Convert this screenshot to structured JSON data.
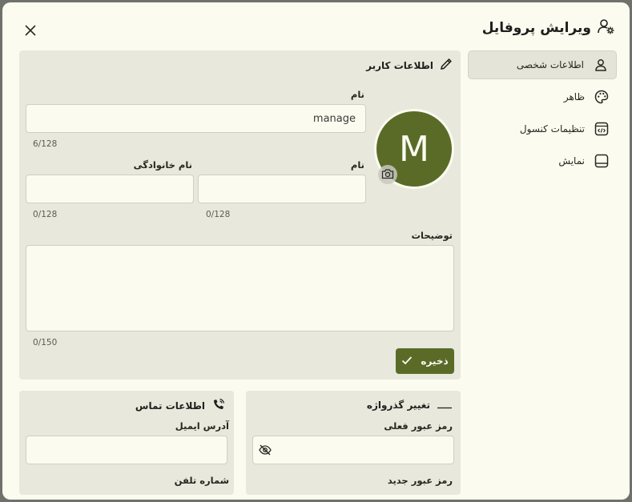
{
  "dialog": {
    "title": "ویرایش پروفایل"
  },
  "sidebar": {
    "items": [
      {
        "label": "اطلاعات شخصی",
        "icon": "person-icon",
        "active": true
      },
      {
        "label": "ظاهر",
        "icon": "palette-icon",
        "active": false
      },
      {
        "label": "تنظیمات کنسول",
        "icon": "console-icon",
        "active": false
      },
      {
        "label": "نمایش",
        "icon": "display-icon",
        "active": false
      }
    ]
  },
  "user_info": {
    "heading": "اطلاعات کاربر",
    "avatar_letter": "M",
    "name_label": "نام",
    "name_value": "manage",
    "name_counter": "6/128",
    "first_name_label": "نام",
    "first_name_value": "",
    "first_name_counter": "0/128",
    "last_name_label": "نام خانوادگی",
    "last_name_value": "",
    "last_name_counter": "0/128",
    "description_label": "توضیحات",
    "description_value": "",
    "description_counter": "0/150",
    "save_label": "ذخیره"
  },
  "password": {
    "heading": "تغییر گذرواژه",
    "current_label": "رمز عبور فعلی",
    "current_value": "",
    "new_label": "رمز عبور جدید"
  },
  "contact": {
    "heading": "اطلاعات تماس",
    "email_label": "آدرس ایمیل",
    "email_value": "",
    "phone_label": "شماره تلفن"
  },
  "colors": {
    "accent": "#5a6b28",
    "background": "#fbfbf0",
    "panel": "#e8e8dd"
  }
}
